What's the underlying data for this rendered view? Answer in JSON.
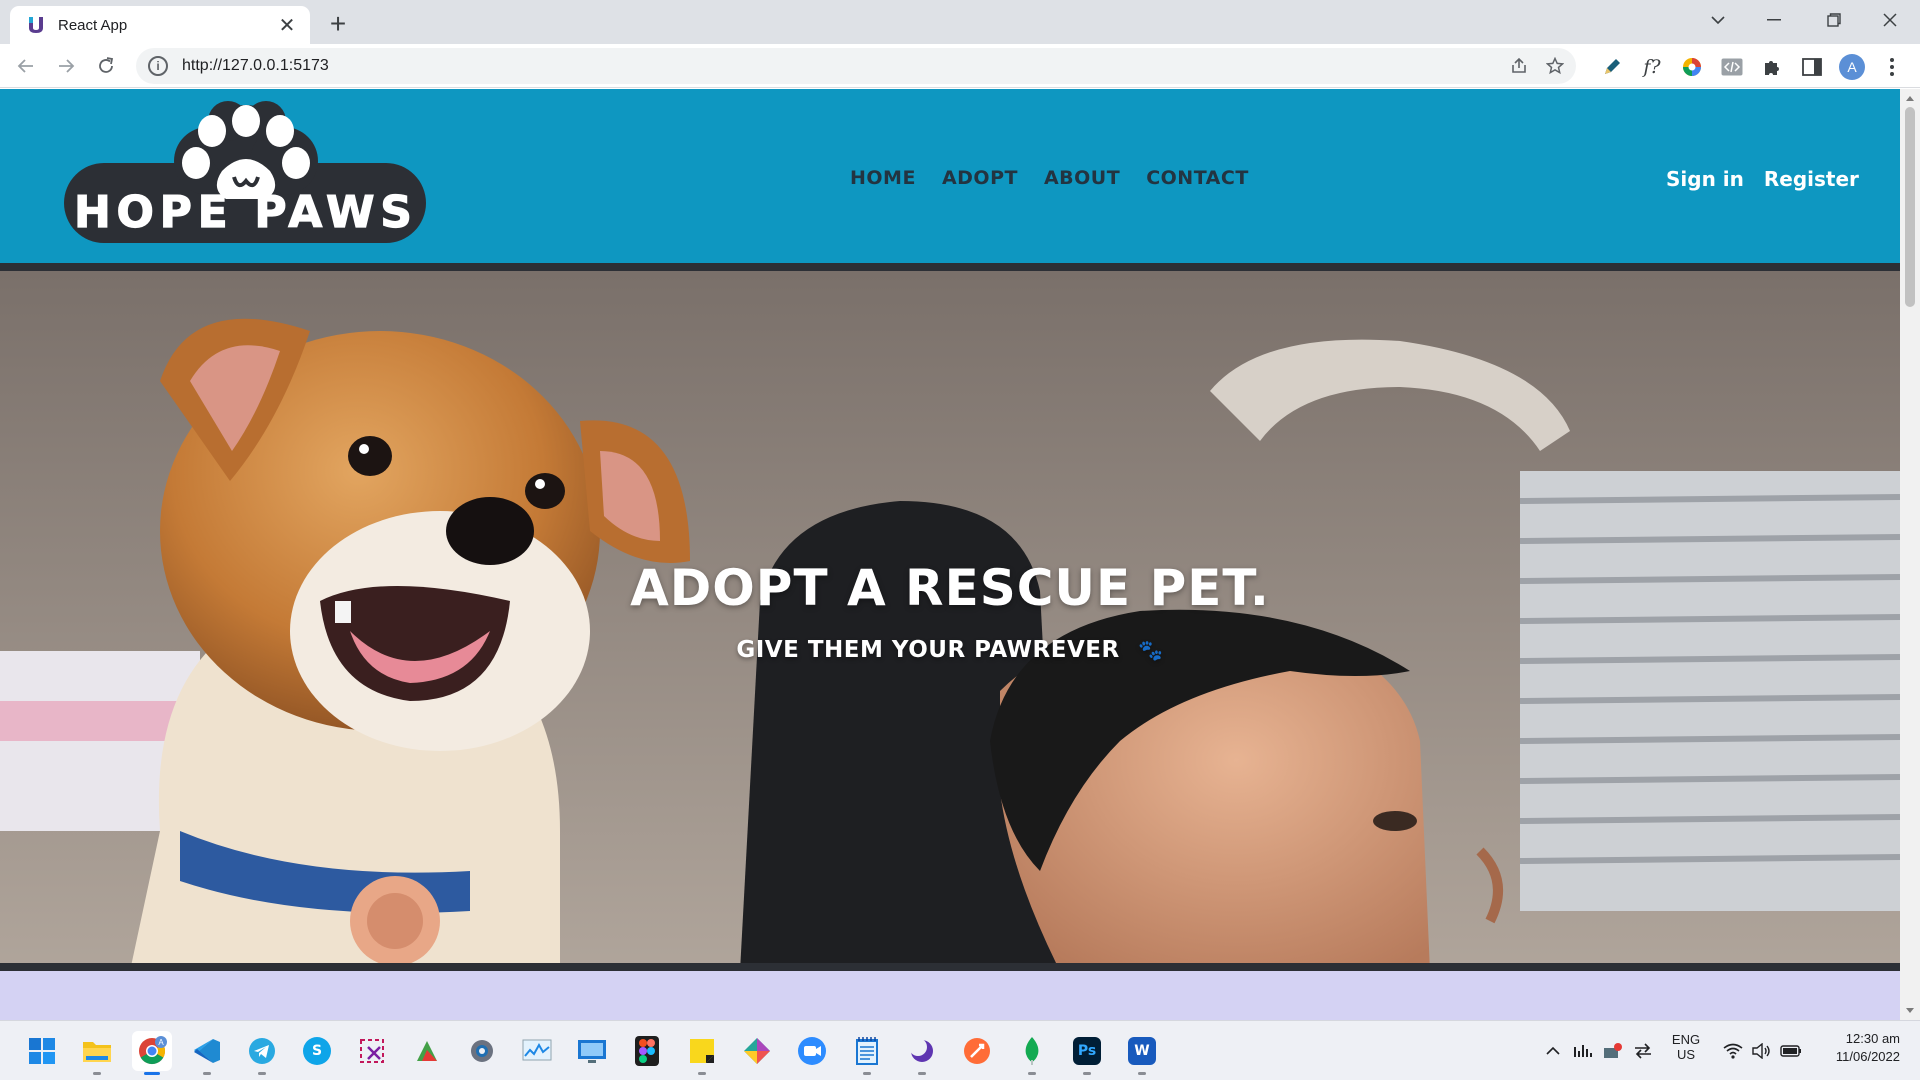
{
  "browser": {
    "tab_title": "React App",
    "tab_close": "✕",
    "new_tab": "+",
    "url": "http://127.0.0.1:5173",
    "extensions": [
      "pen-tool-icon",
      "font-finder-icon",
      "color-picker-icon",
      "code-view-icon",
      "extensions-puzzle-icon",
      "side-panel-icon"
    ],
    "profile_initial": "A",
    "ext_labels": {
      "font_finder": "f?"
    }
  },
  "site": {
    "logo_text": "HOPE PAWS",
    "nav": [
      "HOME",
      "ADOPT",
      "ABOUT",
      "CONTACT"
    ],
    "auth": {
      "sign_in": "Sign in",
      "register": "Register"
    },
    "hero": {
      "title": "ADOPT A RESCUE PET.",
      "subtitle": "GIVE THEM YOUR PAWREVER",
      "paw": "🐾"
    }
  },
  "colors": {
    "header_bg": "#0e97c1",
    "header_border": "#2c2f35",
    "nav_text": "#233441",
    "lower_band": "#d4d2f3"
  },
  "taskbar": {
    "apps": [
      "start-icon",
      "file-explorer-icon",
      "chrome-icon",
      "vscode-icon",
      "telegram-icon",
      "skype-icon",
      "snipping-tool-icon",
      "greenshot-icon",
      "settings-icon",
      "performance-monitor-icon",
      "remote-desktop-icon",
      "figma-icon",
      "sticky-notes-icon",
      "gitkraken-icon",
      "zoom-icon",
      "notepad-icon",
      "night-app-icon",
      "postman-icon",
      "mongodb-icon",
      "photoshop-icon",
      "word-icon"
    ],
    "app_labels": {
      "skype": "S",
      "photoshop": "Ps",
      "word": "W"
    },
    "chrome_badge": "A",
    "language": "ENG",
    "region": "US",
    "time": "12:30 am",
    "date": "11/06/2022"
  }
}
